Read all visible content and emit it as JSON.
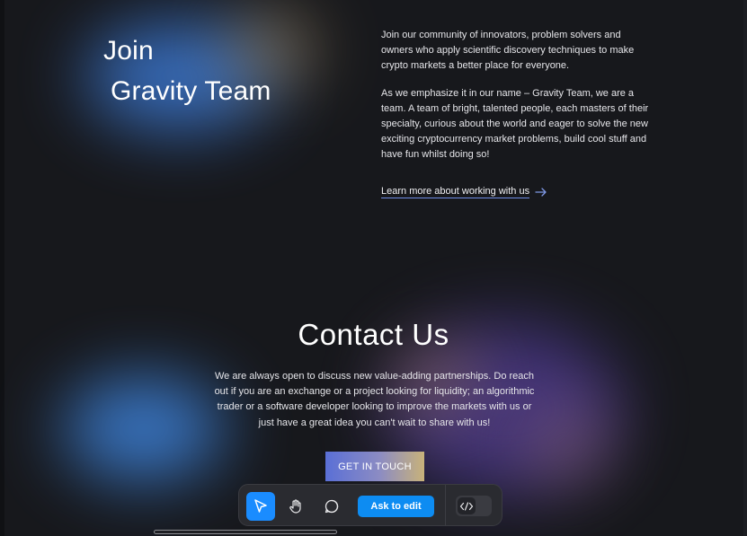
{
  "join": {
    "title_line1": "Join",
    "title_line2": "Gravity Team",
    "paragraph1": "Join our community of innovators, problem solvers and owners who apply scientific discovery techniques to make crypto markets a better place for everyone.",
    "paragraph2": "As we emphasize it in our name – Gravity Team, we are a team. A team of bright, talented people, each masters of their specialty, curious about the world and eager to solve the new exciting cryptocurrency market problems, build cool stuff and have fun whilst doing so!",
    "link_label": "Learn more about working with us",
    "link_icon": "arrow-right-icon"
  },
  "contact": {
    "title": "Contact Us",
    "text": "We are always open to discuss new value-adding partnerships. Do reach out if you are an exchange or a project looking for liquidity; an algorithmic trader or a software developer looking to improve the markets with us or just have a great idea you can't wait to share with us!",
    "button_label": "GET IN TOUCH"
  },
  "toolbar": {
    "select_icon": "cursor-icon",
    "hand_icon": "hand-icon",
    "comment_icon": "comment-icon",
    "ask_to_edit_label": "Ask to edit",
    "code_icon": "code-icon",
    "active_color": "#1a8cff"
  },
  "colors": {
    "background": "#17181c",
    "link_underline": "#6f8de6",
    "accent_blue": "#3d7bd6",
    "accent_purple": "#4d3a8f"
  }
}
